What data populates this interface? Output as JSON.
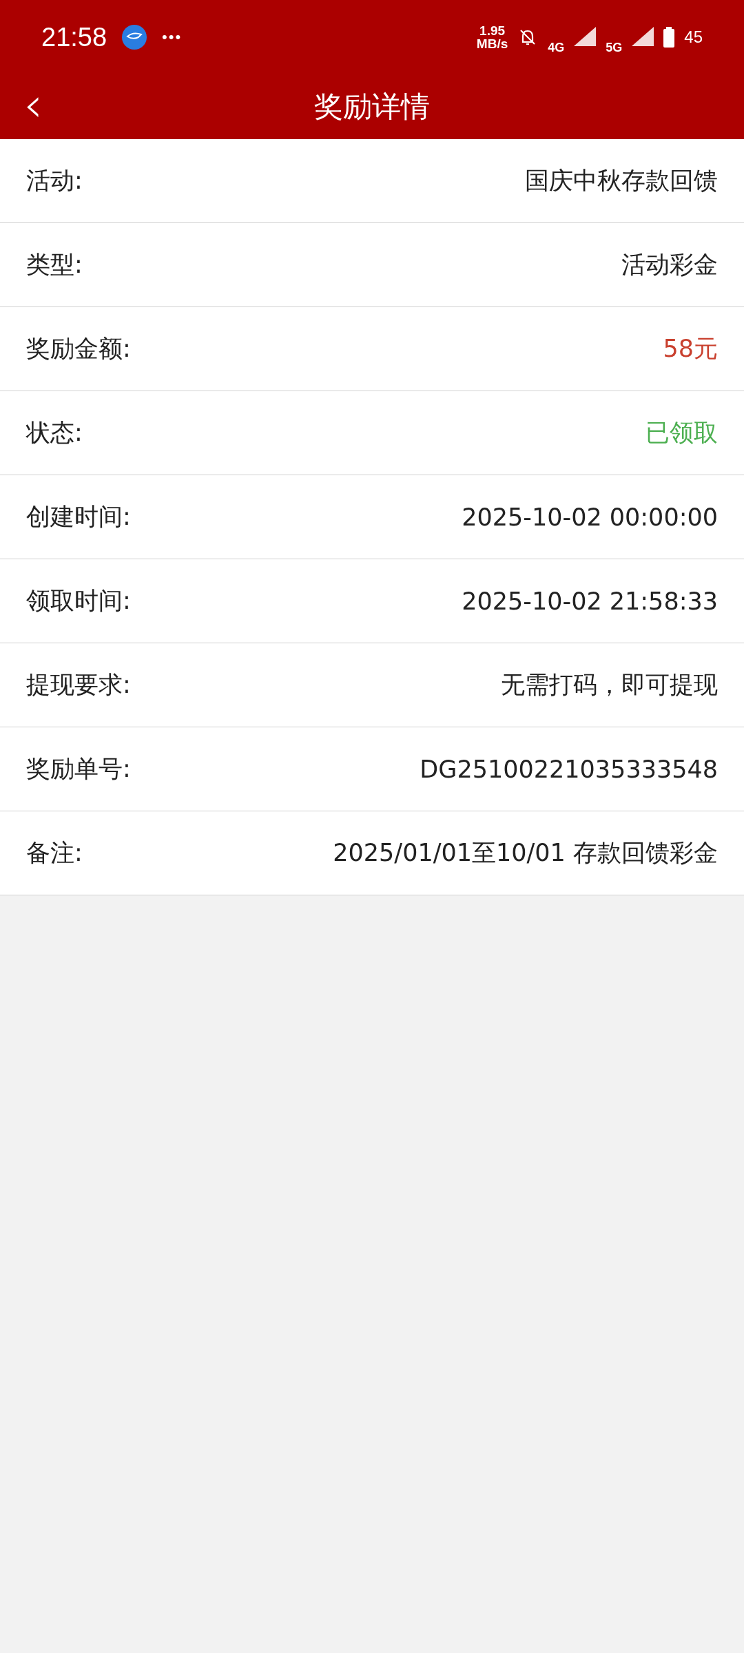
{
  "status_bar": {
    "time": "21:58",
    "more": "•••",
    "speed": "1.95",
    "speed_unit": "MB/s",
    "network_1": "4G",
    "network_2": "5G",
    "battery": "45"
  },
  "nav_bar": {
    "back": "‹",
    "title": "奖励详情"
  },
  "details": [
    {
      "label": "活动:",
      "value": "国庆中秋存款回馈",
      "color": "#222222"
    },
    {
      "label": "类型:",
      "value": "活动彩金",
      "color": "#222222"
    },
    {
      "label": "奖励金额:",
      "value": "58元",
      "color": "#c9402e"
    },
    {
      "label": "状态:",
      "value": "已领取",
      "color": "#4caf50"
    },
    {
      "label": "创建时间:",
      "value": "2025-10-02 00:00:00",
      "color": "#222222"
    },
    {
      "label": "领取时间:",
      "value": "2025-10-02 21:58:33",
      "color": "#222222"
    },
    {
      "label": "提现要求:",
      "value": "无需打码，即可提现",
      "color": "#222222"
    },
    {
      "label": "奖励单号:",
      "value": "DG25100221035333548",
      "color": "#222222"
    },
    {
      "label": "备注:",
      "value": "2025/01/01至10/01 存款回馈彩金",
      "color": "#222222"
    }
  ]
}
